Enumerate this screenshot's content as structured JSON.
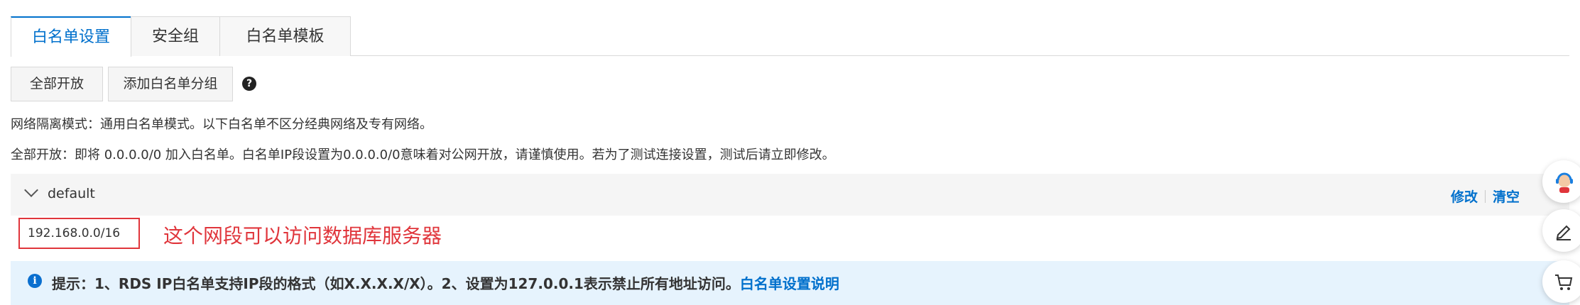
{
  "tabs": [
    {
      "label": "白名单设置",
      "active": true
    },
    {
      "label": "安全组",
      "active": false
    },
    {
      "label": "白名单模板",
      "active": false
    }
  ],
  "toolbar": {
    "open_all_label": "全部开放",
    "add_group_label": "添加白名单分组",
    "help_icon": "?"
  },
  "info": {
    "network_mode": "网络隔离模式：通用白名单模式。以下白名单不区分经典网络及专有网络。",
    "open_all_note": "全部开放：即将 0.0.0.0/0 加入白名单。白名单IP段设置为0.0.0.0/0意味着对公网开放，请谨慎使用。若为了测试连接设置，测试后请立即修改。"
  },
  "group": {
    "name": "default",
    "edit_label": "修改",
    "clear_label": "清空",
    "ip": "192.168.0.0/16",
    "annotation": "这个网段可以访问数据库服务器"
  },
  "tip": {
    "icon": "i",
    "text": "提示：1、RDS IP白名单支持IP段的格式（如X.X.X.X/X）。2、设置为127.0.0.1表示禁止所有地址访问。",
    "link_label": "白名单设置说明"
  },
  "icons": {
    "support": "support-agent-icon",
    "edit": "edit-icon",
    "cart": "cart-icon"
  },
  "colors": {
    "accent": "#0070cc",
    "annotation_red": "#e0353b",
    "tip_bg": "#e6f3fd"
  }
}
